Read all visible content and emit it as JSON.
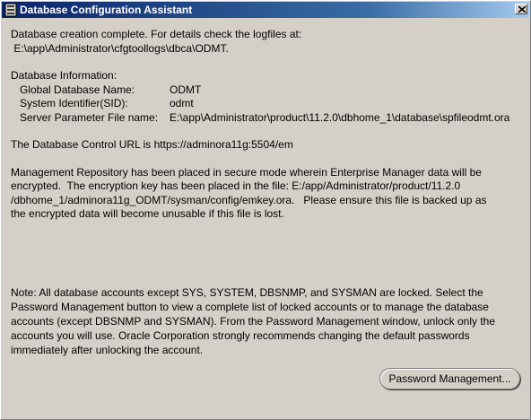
{
  "window": {
    "title": "Database Configuration Assistant"
  },
  "content": {
    "completion_line1": "Database creation complete. For details check the logfiles at:",
    "completion_line2": " E:\\app\\Administrator\\cfgtoollogs\\dbca\\ODMT.",
    "db_info_header": "Database Information:",
    "db_info": [
      {
        "label": "Global Database Name:",
        "value": "ODMT"
      },
      {
        "label": "System Identifier(SID):",
        "value": "odmt"
      },
      {
        "label": "Server Parameter File name:",
        "value": "E:\\app\\Administrator\\product\\11.2.0\\dbhome_1\\database\\spfileodmt.ora"
      }
    ],
    "control_url": "The Database Control URL is https://adminora11g:5504/em",
    "repository_lines": [
      "Management Repository has been placed in secure mode wherein Enterprise Manager data will be",
      "encrypted.  The encryption key has been placed in the file: E:/app/Administrator/product/11.2.0",
      "/dbhome_1/adminora11g_ODMT/sysman/config/emkey.ora.   Please ensure this file is backed up as",
      "the encrypted data will become unusable if this file is lost."
    ],
    "note_lines": [
      "Note: All database accounts except SYS, SYSTEM, DBSNMP, and SYSMAN are locked. Select the",
      "Password Management button to view a complete list of locked accounts or to manage the database",
      "accounts (except DBSNMP and SYSMAN). From the Password Management window, unlock only the",
      "accounts you will use. Oracle Corporation strongly recommends changing the default passwords",
      "immediately after unlocking the account."
    ]
  },
  "buttons": {
    "password_management": "Password Management...",
    "close": "✕"
  }
}
